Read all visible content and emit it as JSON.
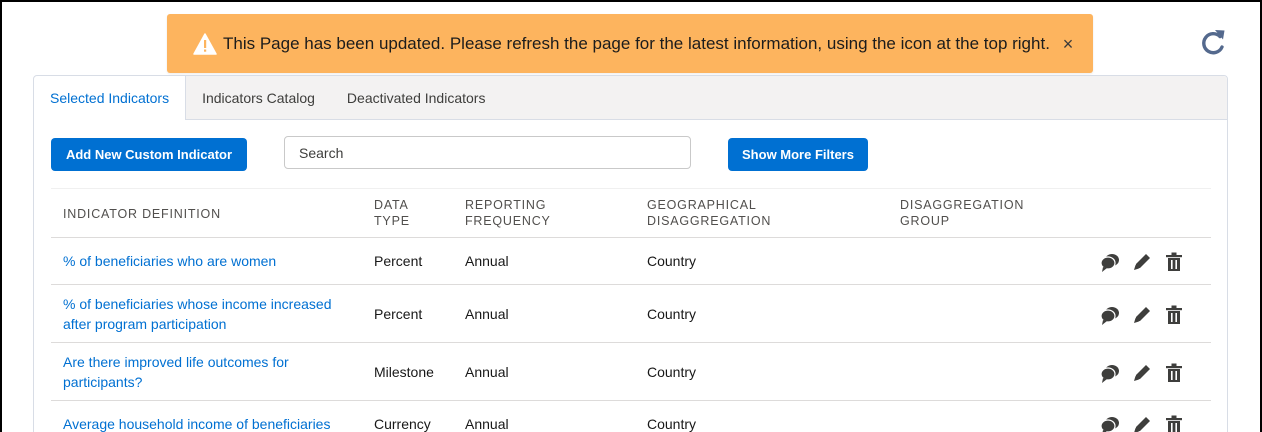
{
  "toast": {
    "message": "This Page has been updated. Please refresh the page for the latest information, using the icon at the top right.",
    "close_glyph": "×",
    "color": "#fdb45e"
  },
  "refresh_icon": "refresh-icon",
  "tabs": [
    {
      "label": "Selected Indicators",
      "active": true
    },
    {
      "label": "Indicators Catalog",
      "active": false
    },
    {
      "label": "Deactivated Indicators",
      "active": false
    }
  ],
  "toolbar": {
    "add_label": "Add New Custom Indicator",
    "search_placeholder": "Search",
    "filters_label": "Show More Filters",
    "accent": "#0070d2"
  },
  "table": {
    "headers": {
      "definition": "INDICATOR DEFINITION",
      "data_type": [
        "DATA",
        "TYPE"
      ],
      "frequency": [
        "REPORTING",
        "FREQUENCY"
      ],
      "geo": [
        "GEOGRAPHICAL",
        "DISAGGREGATION"
      ],
      "group": [
        "DISAGGREGATION",
        "GROUP"
      ]
    },
    "rows": [
      {
        "definition": [
          "% of beneficiaries who are women"
        ],
        "data_type": "Percent",
        "frequency": "Annual",
        "geo": "Country",
        "group": ""
      },
      {
        "definition": [
          "% of beneficiaries whose income increased",
          "after program participation"
        ],
        "data_type": "Percent",
        "frequency": "Annual",
        "geo": "Country",
        "group": ""
      },
      {
        "definition": [
          "Are there improved life outcomes for",
          "participants?"
        ],
        "data_type": "Milestone",
        "frequency": "Annual",
        "geo": "Country",
        "group": ""
      },
      {
        "definition": [
          "Average household income of beneficiaries"
        ],
        "data_type": "Currency",
        "frequency": "Annual",
        "geo": "Country",
        "group": ""
      }
    ],
    "row_actions": [
      "comments-icon",
      "edit-pencil-icon",
      "delete-trash-icon"
    ]
  }
}
